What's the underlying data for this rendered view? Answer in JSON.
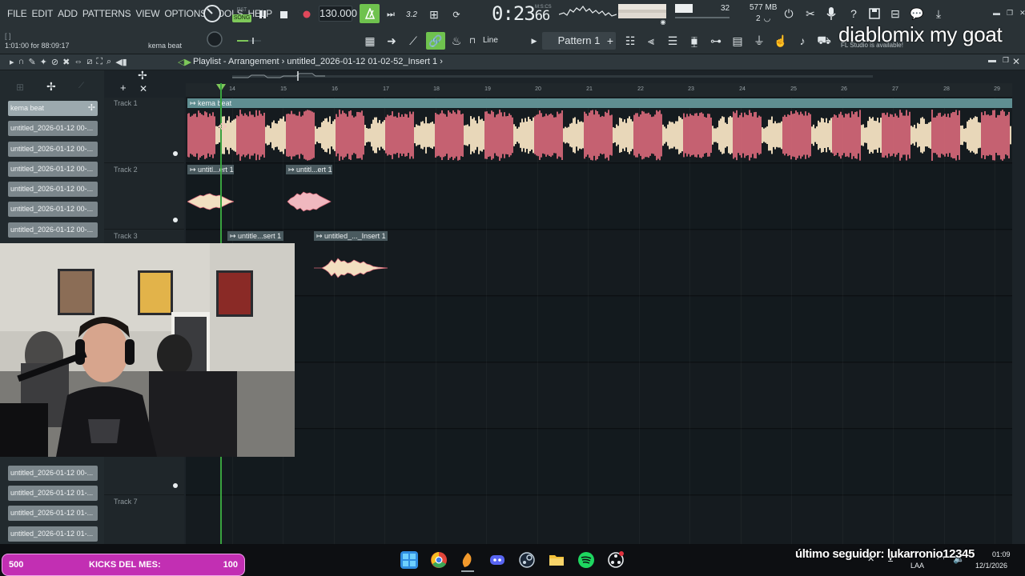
{
  "menu": [
    "FILE",
    "EDIT",
    "ADD",
    "PATTERNS",
    "VIEW",
    "OPTIONS",
    "TOOLS",
    "HELP"
  ],
  "transport": {
    "pat_label": "PAT",
    "song_label": "SONG",
    "tempo": "130.000",
    "time": "0:23",
    "time_frac": "66",
    "time_unit": "M:S:CS",
    "cpu": "32",
    "memory": "577 MB",
    "polyphony": "2"
  },
  "hint": {
    "bracket": "[  ]",
    "left": "1:01:00 for 88:09:17",
    "right": "kema beat"
  },
  "snap": {
    "label": "Line"
  },
  "pattern": {
    "label": "Pattern 1"
  },
  "stream_overlay": {
    "title": "diablomix my goat",
    "update_note": "FL Studio is available!"
  },
  "playlist": {
    "title": "Playlist - Arrangement",
    "project": "untitled_2026-01-12 01-02-52_Insert 1",
    "separator": "›",
    "bar_numbers": [
      "14",
      "15",
      "16",
      "17",
      "18",
      "19",
      "20",
      "21",
      "22",
      "23",
      "24",
      "25",
      "26",
      "27",
      "28",
      "29"
    ],
    "tracks": [
      "Track 1",
      "Track 2",
      "Track 3",
      "",
      "",
      "",
      "Track 7"
    ],
    "clips": [
      {
        "label": "kema beat"
      },
      {
        "label": "untitl...ert 1"
      },
      {
        "label": "untitl...ert 1"
      },
      {
        "label": "untitle...sert 1"
      },
      {
        "label": "untitled_..._Insert 1"
      }
    ]
  },
  "picker": {
    "items": [
      "kema beat",
      "untitled_2026-01-12 00-...",
      "untitled_2026-01-12 00-...",
      "untitled_2026-01-12 00-...",
      "untitled_2026-01-12 00-...",
      "untitled_2026-01-12 00-...",
      "untitled_2026-01-12 00-..."
    ],
    "items_bottom": [
      "untitled_2026-01-12 00-...",
      "untitled_2026-01-12 01-...",
      "untitled_2026-01-12 01-...",
      "untitled_2026-01-12 01-..."
    ]
  },
  "stream_bar": {
    "kicks_left": "500",
    "kicks_label": "KICKS DEL MES:",
    "kicks_right": "100",
    "follower": "último seguidor: lukarronio12345"
  },
  "taskbar": {
    "lang": "LAA",
    "time": "01:09",
    "date": "12/1/2026"
  },
  "colors": {
    "song_active": "#7ec85a",
    "playhead": "#39a23f",
    "wave_red": "#d9697a",
    "wave_cream": "#f4e2c2",
    "kicks_bg": "#c22fb3"
  }
}
